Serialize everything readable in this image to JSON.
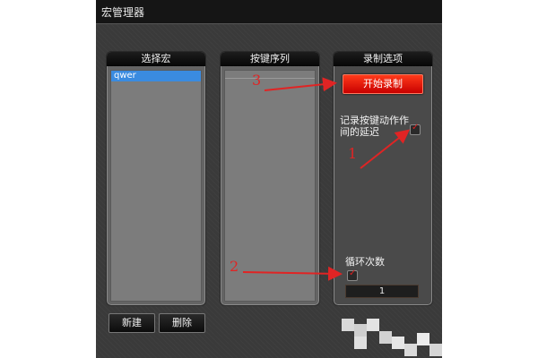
{
  "window": {
    "title": "宏管理器"
  },
  "panels": {
    "macros": {
      "header": "选择宏",
      "items": [
        "qwer"
      ]
    },
    "keys": {
      "header": "按键序列"
    },
    "options": {
      "header": "录制选项",
      "record_button": "开始录制",
      "record_delay_label_line1": "记录按键动作作",
      "record_delay_label_line2": "间的延迟",
      "record_delay_checked": true,
      "loop_label": "循环次数",
      "loop_checked": true,
      "loop_count": "1"
    }
  },
  "footer": {
    "new_button": "新建",
    "delete_button": "删除"
  },
  "annotations": {
    "arrow1": "1",
    "arrow2": "2",
    "arrow3": "3"
  },
  "colors": {
    "annotation": "#e02424",
    "record_button": "#e01010",
    "selection": "#3a8be0"
  }
}
